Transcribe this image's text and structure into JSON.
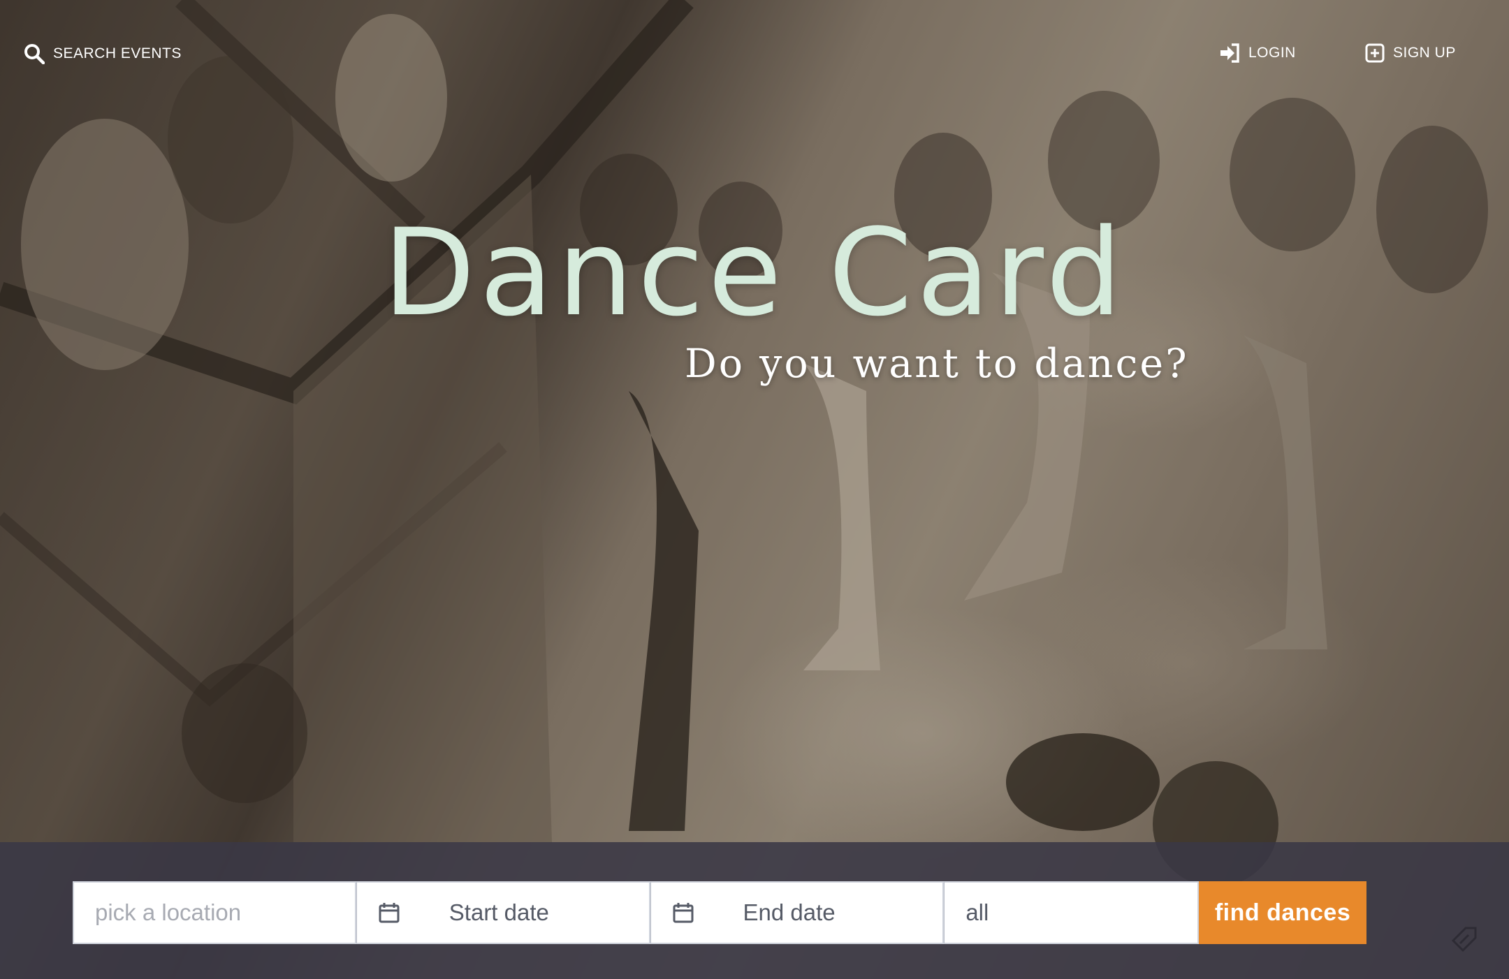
{
  "nav": {
    "search_label": "SEARCH EVENTS",
    "login_label": "LOGIN",
    "signup_label": "SIGN UP"
  },
  "hero": {
    "title": "Dance Card",
    "subtitle": "Do you want to dance?",
    "title_color": "#d6ebdc"
  },
  "search": {
    "location_placeholder": "pick a location",
    "start_date_label": "Start date",
    "end_date_label": "End date",
    "type_value": "all",
    "submit_label": "find dances",
    "submit_color": "#e8892b"
  },
  "icons": {
    "search": "search-icon",
    "login": "login-arrow-icon",
    "signup": "plus-square-icon",
    "calendar": "calendar-icon",
    "corner": "tag-icon"
  }
}
